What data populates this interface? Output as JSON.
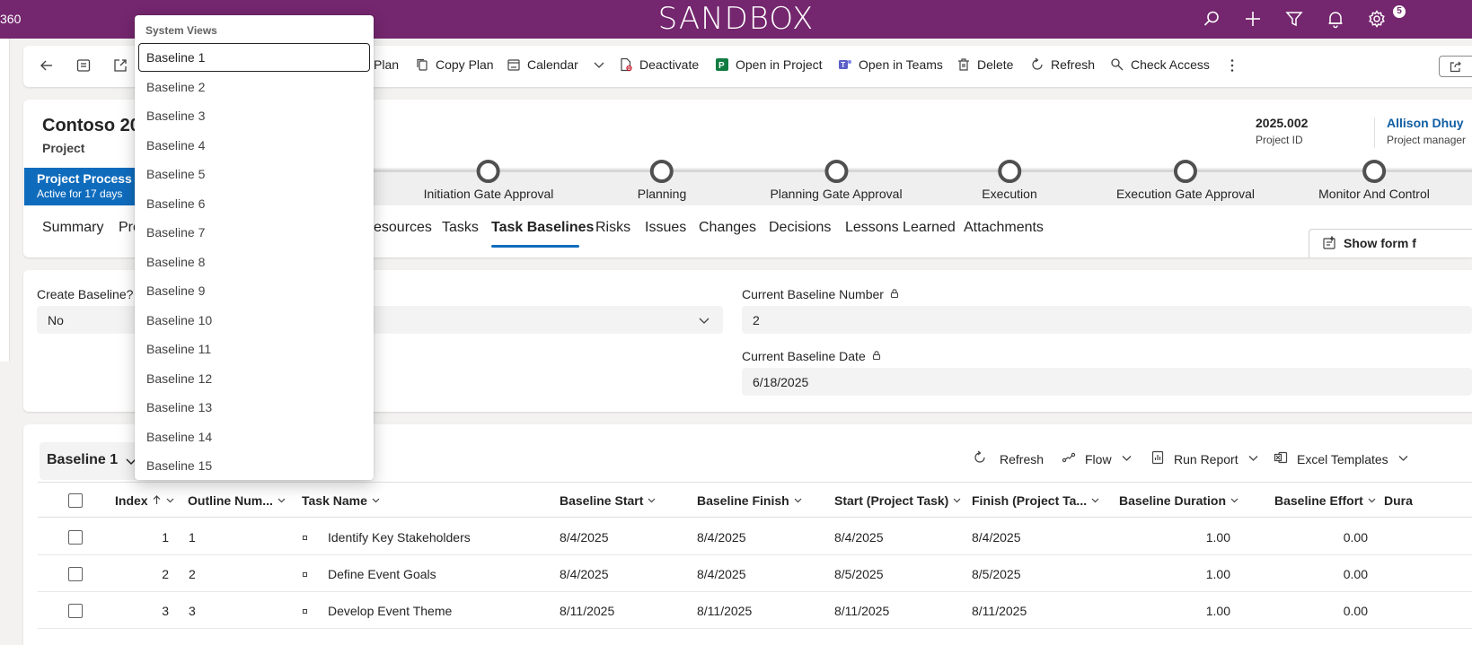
{
  "topbar": {
    "app_fragment": "360",
    "environment": "SANDBOX",
    "notification_count": "5",
    "color": "#74266e"
  },
  "commands": {
    "plan_fragment": "Plan",
    "copy_plan": "Copy Plan",
    "calendar": "Calendar",
    "deactivate": "Deactivate",
    "open_in_project": "Open in Project",
    "open_in_teams": "Open in Teams",
    "delete": "Delete",
    "refresh": "Refresh",
    "check_access": "Check Access"
  },
  "record": {
    "title": "Contoso 202",
    "type": "Project",
    "project_id_value": "2025.002",
    "project_id_label": "Project ID",
    "manager_value": "Allison Dhuy",
    "manager_label": "Project manager"
  },
  "process": {
    "name": "Project Process",
    "status": "Active for 17 days",
    "stages": [
      "Initiation Gate Approval",
      "Planning",
      "Planning Gate Approval",
      "Execution",
      "Execution Gate Approval",
      "Monitor And Control"
    ]
  },
  "tabs": {
    "summary": "Summary",
    "pro_fragment": "Pro",
    "resources_fragment": "esources",
    "tasks": "Tasks",
    "task_baselines": "Task Baselines",
    "risks": "Risks",
    "issues": "Issues",
    "changes": "Changes",
    "decisions": "Decisions",
    "lessons_learned": "Lessons Learned",
    "attachments": "Attachments",
    "active": "Task Baselines"
  },
  "show_form": "Show form f",
  "form": {
    "create_baseline_label": "Create Baseline?",
    "create_baseline_value": "No",
    "current_baseline_number_label": "Current Baseline Number",
    "current_baseline_number_value": "2",
    "current_baseline_date_label": "Current Baseline Date",
    "current_baseline_date_value": "6/18/2025"
  },
  "grid": {
    "view_name": "Baseline 1",
    "commands": {
      "refresh": "Refresh",
      "flow": "Flow",
      "run_report": "Run Report",
      "excel_templates": "Excel Templates"
    },
    "columns": {
      "index": "Index",
      "outline": "Outline Num...",
      "task_name": "Task Name",
      "baseline_start": "Baseline Start",
      "baseline_finish": "Baseline Finish",
      "start_task": "Start (Project Task)",
      "finish_task": "Finish (Project Ta...",
      "baseline_duration": "Baseline Duration",
      "baseline_effort": "Baseline Effort",
      "dura_fragment": "Dura"
    },
    "rows": [
      {
        "index": "1",
        "outline": "1",
        "task": "Identify Key Stakeholders",
        "bstart": "8/4/2025",
        "bfinish": "8/4/2025",
        "start": "8/4/2025",
        "finish": "8/4/2025",
        "duration": "1.00",
        "effort": "0.00"
      },
      {
        "index": "2",
        "outline": "2",
        "task": "Define Event Goals",
        "bstart": "8/4/2025",
        "bfinish": "8/4/2025",
        "start": "8/5/2025",
        "finish": "8/5/2025",
        "duration": "1.00",
        "effort": "0.00"
      },
      {
        "index": "3",
        "outline": "3",
        "task": "Develop Event Theme",
        "bstart": "8/11/2025",
        "bfinish": "8/11/2025",
        "start": "8/11/2025",
        "finish": "8/11/2025",
        "duration": "1.00",
        "effort": "0.00"
      }
    ]
  },
  "dropdown": {
    "header": "System Views",
    "items": [
      "Baseline 1",
      "Baseline 2",
      "Baseline 3",
      "Baseline 4",
      "Baseline 5",
      "Baseline 6",
      "Baseline 7",
      "Baseline 8",
      "Baseline 9",
      "Baseline 10",
      "Baseline 11",
      "Baseline 12",
      "Baseline 13",
      "Baseline 14",
      "Baseline 15"
    ],
    "selected": "Baseline 1"
  }
}
